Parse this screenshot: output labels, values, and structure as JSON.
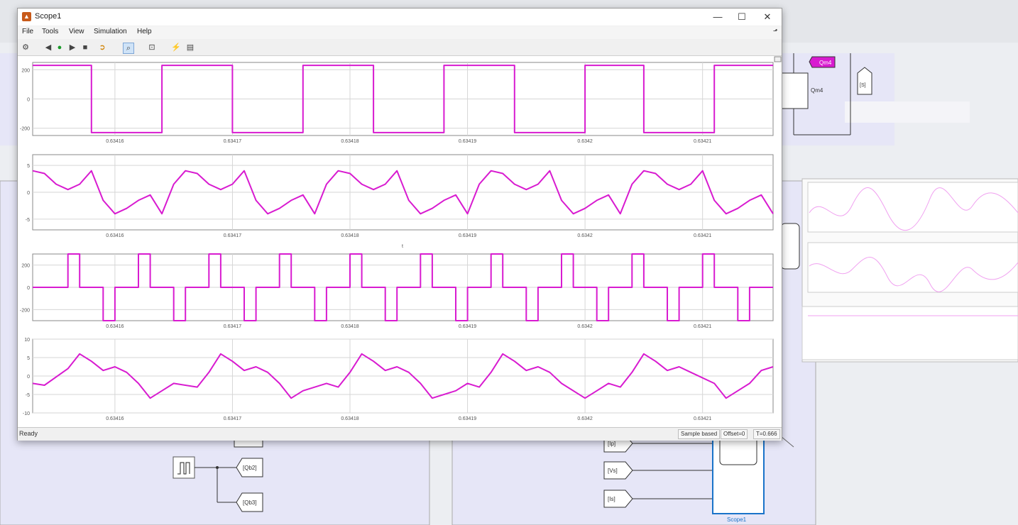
{
  "window": {
    "title": "Scope1",
    "menus": [
      "File",
      "Tools",
      "View",
      "Simulation",
      "Help"
    ]
  },
  "toolbar": {
    "icons": [
      "gear-icon",
      "step-back-icon",
      "run-icon",
      "step-forward-icon",
      "stop-icon",
      "highlight-icon",
      "zoom-icon",
      "fit-icon",
      "trigger-icon",
      "measure-icon"
    ]
  },
  "plots": {
    "x_ticks": [
      "0.63416",
      "0.63417",
      "0.63418",
      "0.63419",
      "0.6342",
      "0.63421"
    ],
    "x_cursor_label": "t"
  },
  "chart_data": [
    {
      "type": "line",
      "title": "",
      "xlabel": "",
      "ylabel": "",
      "y_ticks": [
        "200",
        "0",
        "-200"
      ],
      "ylim": [
        -250,
        250
      ],
      "series": [
        {
          "x": [
            0.634153,
            0.634158,
            0.634158,
            0.634164,
            0.634164,
            0.63417,
            0.63417,
            0.634176,
            0.634176,
            0.634182,
            0.634182,
            0.634188,
            0.634188,
            0.634194,
            0.634194,
            0.6342,
            0.6342,
            0.634205,
            0.634205,
            0.634211,
            0.634211,
            0.634216
          ],
          "y": [
            230,
            230,
            -230,
            -230,
            230,
            230,
            -230,
            -230,
            230,
            230,
            -230,
            -230,
            230,
            230,
            -230,
            -230,
            230,
            230,
            -230,
            -230,
            230,
            230
          ]
        }
      ]
    },
    {
      "type": "line",
      "title": "",
      "xlabel": "",
      "ylabel": "",
      "y_ticks": [
        "5",
        "0",
        "-5"
      ],
      "ylim": [
        -7,
        7
      ],
      "series": [
        {
          "x": [
            0.634153,
            0.634154,
            0.634155,
            0.634156,
            0.634157,
            0.634158,
            0.634159,
            0.63416,
            0.634161,
            0.634162,
            0.634163,
            0.634164,
            0.634165,
            0.634166,
            0.634167,
            0.634168,
            0.634169,
            0.63417,
            0.634171,
            0.634172,
            0.634173,
            0.634174,
            0.634175,
            0.634176,
            0.634177,
            0.634178,
            0.634179,
            0.63418,
            0.634181,
            0.634182,
            0.634183,
            0.634184,
            0.634185,
            0.634186,
            0.634187,
            0.634188,
            0.634189,
            0.63419,
            0.634191,
            0.634192,
            0.634193,
            0.634194,
            0.634195,
            0.634196,
            0.634197,
            0.634198,
            0.634199,
            0.6342,
            0.634201,
            0.634202,
            0.634203,
            0.634204,
            0.634205,
            0.634206,
            0.634207,
            0.634208,
            0.634209,
            0.63421,
            0.634211,
            0.634212,
            0.634213,
            0.634214,
            0.634215,
            0.634216
          ],
          "y": [
            4,
            3.5,
            1.5,
            0.5,
            1.5,
            4,
            -1.5,
            -4,
            -3,
            -1.5,
            -0.5,
            -4,
            1.5,
            4,
            3.5,
            1.5,
            0.5,
            1.5,
            4,
            -1.5,
            -4,
            -3,
            -1.5,
            -0.5,
            -4,
            1.5,
            4,
            3.5,
            1.5,
            0.5,
            1.5,
            4,
            -1.5,
            -4,
            -3,
            -1.5,
            -0.5,
            -4,
            1.5,
            4,
            3.5,
            1.5,
            0.5,
            1.5,
            4,
            -1.5,
            -4,
            -3,
            -1.5,
            -0.5,
            -4,
            1.5,
            4,
            3.5,
            1.5,
            0.5,
            1.5,
            4,
            -1.5,
            -4,
            -3,
            -1.5,
            -0.5,
            -4
          ]
        }
      ]
    },
    {
      "type": "line",
      "title": "",
      "xlabel": "",
      "ylabel": "",
      "y_ticks": [
        "200",
        "0",
        "-200"
      ],
      "ylim": [
        -300,
        300
      ],
      "series": [
        {
          "x": [
            0.634153,
            0.634156,
            0.634156,
            0.634157,
            0.634157,
            0.634159,
            0.634159,
            0.63416,
            0.63416,
            0.634162,
            0.634162,
            0.634163,
            0.634163,
            0.634165,
            0.634165,
            0.634166,
            0.634166,
            0.634168,
            0.634168,
            0.634169,
            0.634169,
            0.634171,
            0.634171,
            0.634172,
            0.634172,
            0.634174,
            0.634174,
            0.634175,
            0.634175,
            0.634177,
            0.634177,
            0.634178,
            0.634178,
            0.63418,
            0.63418,
            0.634181,
            0.634181,
            0.634183,
            0.634183,
            0.634184,
            0.634184,
            0.634186,
            0.634186,
            0.634187,
            0.634187,
            0.634189,
            0.634189,
            0.63419,
            0.63419,
            0.634192,
            0.634192,
            0.634193,
            0.634193,
            0.634195,
            0.634195,
            0.634196,
            0.634196,
            0.634198,
            0.634198,
            0.634199,
            0.634199,
            0.634201,
            0.634201,
            0.634202,
            0.634202,
            0.634204,
            0.634204,
            0.634205,
            0.634205,
            0.634207,
            0.634207,
            0.634208,
            0.634208,
            0.63421,
            0.63421,
            0.634211,
            0.634211,
            0.634213,
            0.634213,
            0.634214,
            0.634214,
            0.634216
          ],
          "y": [
            0,
            0,
            300,
            300,
            0,
            0,
            -300,
            -300,
            0,
            0,
            300,
            300,
            0,
            0,
            -300,
            -300,
            0,
            0,
            300,
            300,
            0,
            0,
            -300,
            -300,
            0,
            0,
            300,
            300,
            0,
            0,
            -300,
            -300,
            0,
            0,
            300,
            300,
            0,
            0,
            -300,
            -300,
            0,
            0,
            300,
            300,
            0,
            0,
            -300,
            -300,
            0,
            0,
            300,
            300,
            0,
            0,
            -300,
            -300,
            0,
            0,
            300,
            300,
            0,
            0,
            -300,
            -300,
            0,
            0,
            300,
            300,
            0,
            0,
            -300,
            -300,
            0,
            0,
            300,
            300,
            0,
            0,
            -300,
            -300,
            0,
            0
          ]
        }
      ]
    },
    {
      "type": "line",
      "title": "",
      "xlabel": "",
      "ylabel": "",
      "y_ticks": [
        "10",
        "5",
        "0",
        "-5",
        "-10"
      ],
      "ylim": [
        -10,
        10
      ],
      "series": [
        {
          "x": [
            0.634153,
            0.634154,
            0.634156,
            0.634157,
            0.634158,
            0.634159,
            0.63416,
            0.634161,
            0.634162,
            0.634163,
            0.634164,
            0.634165,
            0.634167,
            0.634168,
            0.634169,
            0.63417,
            0.634171,
            0.634172,
            0.634173,
            0.634174,
            0.634175,
            0.634176,
            0.634178,
            0.634179,
            0.63418,
            0.634181,
            0.634182,
            0.634183,
            0.634184,
            0.634185,
            0.634186,
            0.634187,
            0.634189,
            0.63419,
            0.634191,
            0.634192,
            0.634193,
            0.634194,
            0.634195,
            0.634196,
            0.634197,
            0.634198,
            0.6342,
            0.634201,
            0.634202,
            0.634203,
            0.634204,
            0.634205,
            0.634206,
            0.634207,
            0.634208,
            0.634209,
            0.634211,
            0.634212,
            0.634213,
            0.634214,
            0.634215,
            0.634216
          ],
          "y": [
            -2,
            -2.5,
            2,
            6,
            4,
            1.5,
            2.5,
            1,
            -2,
            -6,
            -4,
            -2,
            -3,
            1,
            6,
            4,
            1.5,
            2.5,
            1,
            -2,
            -6,
            -4,
            -2,
            -3,
            1,
            6,
            4,
            1.5,
            2.5,
            1,
            -2,
            -6,
            -4,
            -2,
            -3,
            1,
            6,
            4,
            1.5,
            2.5,
            1,
            -2,
            -6,
            -4,
            -2,
            -3,
            1,
            6,
            4,
            1.5,
            2.5,
            1,
            -2,
            -6,
            -4,
            -2,
            1.5,
            2.5
          ]
        }
      ]
    }
  ],
  "statusbar": {
    "ready": "Ready",
    "mode": "Sample based",
    "offset": "Offset=0",
    "time": "T=0.666"
  },
  "bg_blocks": {
    "tag_top": "Qm4",
    "label_qm4": "Qm4",
    "goto_qb2": "[Qb2]",
    "goto_qb3": "[Qb3]",
    "from_ip": "[Ip]",
    "from_vs": "[Vs]",
    "from_is": "[Is]",
    "scope_name": "Scope1",
    "small_tag": "[S]"
  }
}
